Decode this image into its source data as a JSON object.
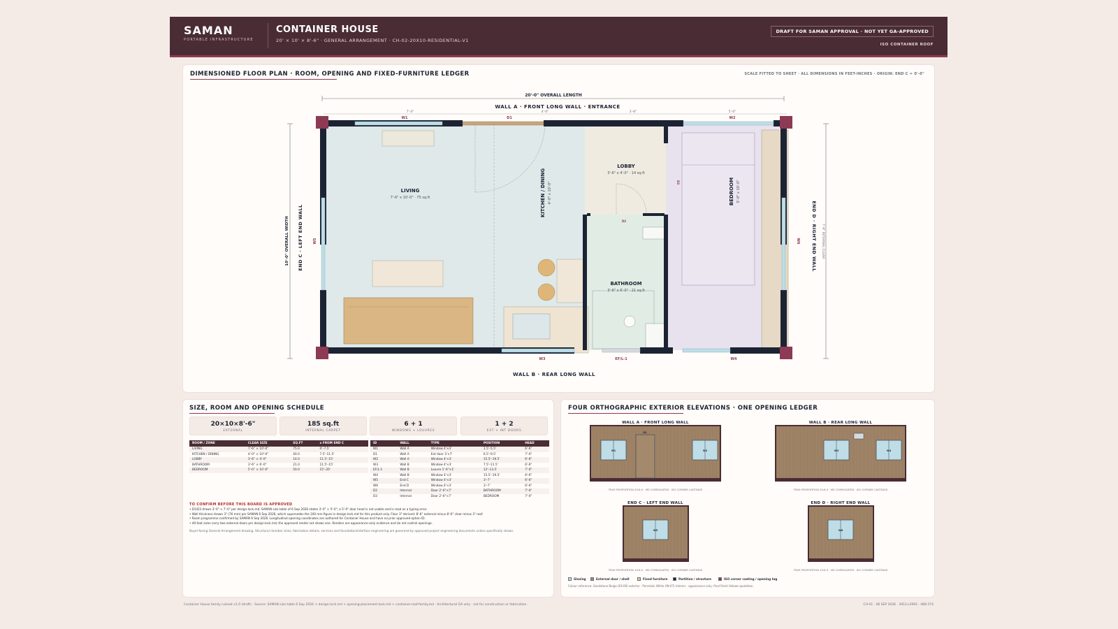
{
  "header": {
    "brand": "SAMAN",
    "brand_sub": "PORTABLE INFRASTRUCTURE",
    "title": "CONTAINER HOUSE",
    "subtitle": "20' × 10' × 8'-6\" · GENERAL ARRANGEMENT · CH-02-20X10-RESIDENTIAL-V1",
    "draft_badge": "DRAFT FOR SAMAN APPROVAL · NOT YET GA-APPROVED",
    "roof_tag": "ISO CONTAINER ROOF"
  },
  "plan": {
    "title": "DIMENSIONED FLOOR PLAN · ROOM, OPENING AND FIXED-FURNITURE LEDGER",
    "note": "SCALE FITTED TO SHEET · ALL DIMENSIONS IN FEET-INCHES · ORIGIN: END C = 0'-0\"",
    "overall_length": "20'-0\" OVERALL LENGTH",
    "overall_width": "10'-0\" OVERALL WIDTH",
    "internal_clear": "7'-9\" INTERNAL CLEAR",
    "wall_a": "WALL A · FRONT LONG WALL · ENTRANCE",
    "wall_b": "WALL B · REAR LONG WALL",
    "wall_c": "END C · LEFT END WALL",
    "wall_d": "END D · RIGHT END WALL",
    "segment_dims": [
      "7'-4\"",
      "4'-0\"",
      "3'-6\"",
      "5'-0\""
    ],
    "opening_tags": {
      "w1": "W1",
      "d1": "D1",
      "w2": "W2",
      "w3": "W3",
      "efl1": "EF/L-1",
      "w4": "W4",
      "w5": "W5",
      "w6": "W6",
      "d2": "D2",
      "d3": "D3"
    },
    "rooms": {
      "living": {
        "name": "LIVING",
        "size": "7'-6\" x 10'-0\" · 75 sq.ft"
      },
      "kitchen": {
        "name": "KITCHEN / DINING",
        "size": "4'-0\" x 10'-0\""
      },
      "lobby": {
        "name": "LOBBY",
        "size": "3'-6\" x 4'-0\" · 14 sq.ft"
      },
      "bathroom": {
        "name": "BATHROOM",
        "size": "3'-6\" x 6'-0\" · 21 sq.ft"
      },
      "bedroom": {
        "name": "BEDROOM",
        "size": "5'-0\" x 10'-0\""
      }
    }
  },
  "schedule": {
    "title": "SIZE, ROOM AND OPENING SCHEDULE",
    "metrics": [
      {
        "value": "20×10×8'-6\"",
        "label": "EXTERNAL"
      },
      {
        "value": "185 sq.ft",
        "label": "INTERNAL CARPET"
      },
      {
        "value": "6 + 1",
        "label": "WINDOWS + LOUVRES"
      },
      {
        "value": "1 + 2",
        "label": "EXT + INT DOORS"
      }
    ],
    "room_table": {
      "headers": [
        "ROOM / ZONE",
        "CLEAR SIZE",
        "SQ.FT",
        "x FROM END C"
      ],
      "rows": [
        [
          "LIVING",
          "7'-6\" × 10'-0\"",
          "75.0",
          "0'–7.5'"
        ],
        [
          "KITCHEN / DINING",
          "4'-0\" × 10'-0\"",
          "40.0",
          "7.5'–11.5'"
        ],
        [
          "LOBBY",
          "3'-6\" × 4'-0\"",
          "14.0",
          "11.5'–15'"
        ],
        [
          "BATHROOM",
          "3'-6\" × 6'-0\"",
          "21.0",
          "11.5'–15'"
        ],
        [
          "BEDROOM",
          "5'-0\" × 10'-0\"",
          "50.0",
          "15'–20'"
        ]
      ]
    },
    "opening_table": {
      "headers": [
        "ID",
        "WALL",
        "TYPE",
        "POSITION",
        "HEAD"
      ],
      "rows": [
        [
          "W1",
          "Wall A",
          "Window 4'×3'",
          "1.5'–5.5'",
          "6'-6\""
        ],
        [
          "D1",
          "Wall A",
          "Ext door 3'×7'",
          "6.5'–9.5'",
          "7'-0\""
        ],
        [
          "W2",
          "Wall A",
          "Window 4'×3'",
          "15.5'–19.5'",
          "6'-6\""
        ],
        [
          "W3",
          "Wall B",
          "Window 4'×3'",
          "7.5'–11.5'",
          "6'-6\""
        ],
        [
          "EF/L-1",
          "Wall B",
          "Louvre 1'-6\"×1'",
          "12'–13.5'",
          "7'-0\""
        ],
        [
          "W4",
          "Wall B",
          "Window 4'×3'",
          "15.5'–19.5'",
          "6'-6\""
        ],
        [
          "W5",
          "End C",
          "Window 4'×3'",
          "3'–7'",
          "6'-6\""
        ],
        [
          "W6",
          "End D",
          "Window 4'×3'",
          "3'–7'",
          "6'-6\""
        ],
        [
          "D2",
          "Internal",
          "Door 2'-6\"×7'",
          "BATHROOM",
          "7'-0\""
        ],
        [
          "D3",
          "Internal",
          "Door 2'-6\"×7'",
          "BEDROOM",
          "7'-0\""
        ]
      ]
    },
    "confirm_head": "TO CONFIRM BEFORE THIS BOARD IS APPROVED",
    "confirm_items": [
      "• D1/D3 drawn 3'-0\" × 7'-0\" per design-lock.md. SAMAN size table of 6 Sep 2026 states 3'-0\" × 5'-0\"; a 5'-0\" door head is not usable and is read as a typing error.",
      "• Wall thickness drawn 3\" (76 mm) per SAMAN 6 Sep 2026, which supersedes the 100 mm figure in design-lock.md for this product only. Floor 3\" derived: 8'-6\" external minus 8'-0\" clear minus 3\" roof.",
      "• Room programme confirmed by SAMAN 6 Sep 2026. Longitudinal opening coordinates are authored for Container House and have no prior approved option ID.",
      "• 40-foot sizes carry two external doors per design-lock.md; the approved render set shows one. Renders are appearance-only evidence and do not control openings."
    ],
    "buyer_note": "Buyer-facing General Arrangement drawing. Structural member sizes, fabrication details, services and foundation/interface engineering are governed by approved project engineering documents unless specifically shown."
  },
  "elevations": {
    "title": "FOUR ORTHOGRAPHIC EXTERIOR ELEVATIONS · ONE OPENING LEDGER",
    "items": [
      {
        "title": "WALL A · FRONT LONG WALL",
        "caption": "TRUE PROPORTION 20:8.5 · MS CORRUGATED · ISO CORNER CASTINGS",
        "tags": [
          "W1",
          "D1",
          "W2"
        ]
      },
      {
        "title": "WALL B · REAR LONG WALL",
        "caption": "TRUE PROPORTION 20:8.5 · MS CORRUGATED · ISO CORNER CASTINGS",
        "tags": [
          "W3",
          "W4"
        ]
      },
      {
        "title": "END C · LEFT END WALL",
        "caption": "TRUE PROPORTION 10:8.5 · MS CORRUGATED · ISO CORNER CASTINGS",
        "tags": [
          "W5"
        ]
      },
      {
        "title": "END D · RIGHT END WALL",
        "caption": "TRUE PROPORTION 10:8.5 · MS CORRUGATED · ISO CORNER CASTINGS",
        "tags": [
          "W6"
        ]
      }
    ],
    "legend": [
      {
        "label": "Glazing",
        "color": "#bfdde6"
      },
      {
        "label": "External door / shell",
        "color": "#a5896c"
      },
      {
        "label": "Fixed furniture",
        "color": "#e6c9a3"
      },
      {
        "label": "Partition / structure",
        "color": "#1c2333"
      },
      {
        "label": "ISO corner casting / opening tag",
        "color": "#8d3a55"
      }
    ],
    "colour_note": "Colour reference: Sandstone Beige (EX-06) exterior · Porcelain White (IN-07) interior · appearance only; final finish follows quotation."
  },
  "footer": {
    "left": "Container House family ruleset v1.0 (draft) · Source: SAMAN size table 6 Sep 2026 + design-lock.md + opening-placement-lock.md + container-roof-family.md · Architectural GA only · not for construction or fabrication.",
    "right": "CH-V1 · 06 SEP 2026 · 3912×2992 · 489:374"
  },
  "colors": {
    "banner": "#4a2c34",
    "accent": "#8d3a55",
    "structure": "#1c2333",
    "shell": "#a5896c",
    "glazing": "#bfdde6"
  }
}
